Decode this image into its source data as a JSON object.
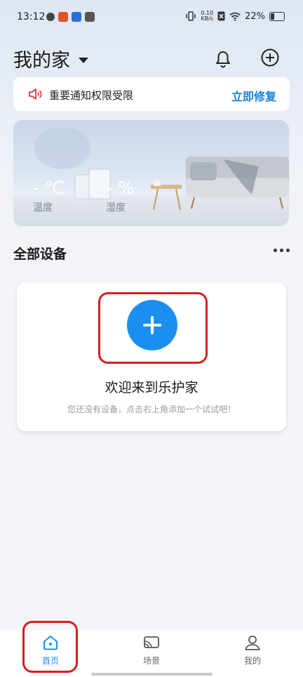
{
  "status_bar": {
    "time": "13:12",
    "speed_value": "0.10",
    "speed_unit": "KB/s",
    "battery": "22%"
  },
  "header": {
    "title": "我的家"
  },
  "notice": {
    "text": "重要通知权限受限",
    "action": "立即修复"
  },
  "room": {
    "temperature": "- ℃",
    "temperature_label": "温度",
    "humidity": "- %",
    "humidity_label": "湿度"
  },
  "devices": {
    "section_title": "全部设备",
    "welcome_title": "欢迎来到乐护家",
    "welcome_sub": "您还没有设备，点击右上角添加一个试试吧！"
  },
  "tabs": [
    {
      "label": "首页",
      "icon": "home-icon",
      "active": true
    },
    {
      "label": "场景",
      "icon": "scene-icon",
      "active": false
    },
    {
      "label": "我的",
      "icon": "profile-icon",
      "active": false
    }
  ],
  "colors": {
    "accent": "#1b8ff0",
    "link": "#1582d6",
    "highlight_box": "#d5201f"
  }
}
